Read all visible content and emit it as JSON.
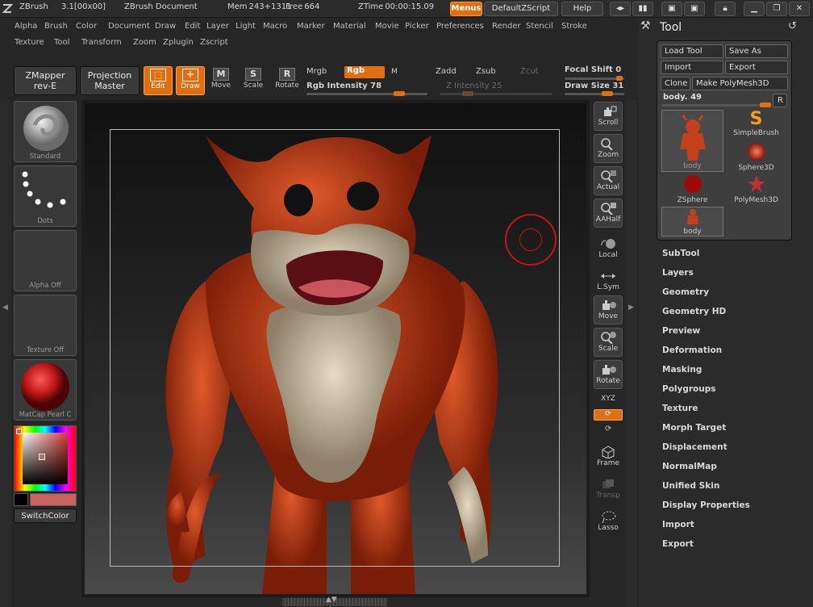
{
  "titlebar": {
    "app": "ZBrush",
    "version": "3.1[00x00]",
    "document": "ZBrush Document",
    "mem": "Mem 243+1311",
    "free": "Free 664",
    "ztime": "ZTime 00:00:15.09",
    "menus_btn": "Menus",
    "script_btn": "DefaultZScript",
    "help_btn": "Help"
  },
  "menu_row1": [
    "Alpha",
    "Brush",
    "Color",
    "Document",
    "Draw",
    "Edit",
    "Layer",
    "Light",
    "Macro",
    "Marker",
    "Material",
    "Movie",
    "Picker",
    "Preferences",
    "Render",
    "Stencil",
    "Stroke"
  ],
  "menu_row2": [
    "Texture",
    "Tool",
    "Transform",
    "Zoom",
    "Zplugin",
    "Zscript"
  ],
  "toolbar": {
    "zmapper": "ZMapper",
    "zmapper_sub": "rev-E",
    "projection": "Projection",
    "projection_sub": "Master",
    "edit": "Edit",
    "draw": "Draw",
    "move": "Move",
    "scale": "Scale",
    "rotate": "Rotate",
    "mrgb": "Mrgb",
    "rgb": "Rgb",
    "m": "M",
    "zadd": "Zadd",
    "zsub": "Zsub",
    "zcut": "Zcut",
    "rgb_intensity": "Rgb Intensity 78",
    "z_intensity": "Z Intensity 25",
    "focal_shift": "Focal Shift 0",
    "draw_size": "Draw Size 31",
    "values": {
      "rgb_intensity": 78,
      "z_intensity": 25,
      "focal_shift": 0,
      "draw_size": 31
    }
  },
  "shelf": {
    "brush": "Standard",
    "stroke": "Dots",
    "alpha": "Alpha  Off",
    "texture": "Texture  Off",
    "material": "MatCap  Pearl  C",
    "switch": "SwitchColor"
  },
  "right_strip": {
    "scroll": "Scroll",
    "zoom": "Zoom",
    "actual": "Actual",
    "aahalf": "AAHalf",
    "local": "Local",
    "lsym": "L.Sym",
    "move": "Move",
    "scale": "Scale",
    "rotate": "Rotate",
    "xyz": "XYZ",
    "frame": "Frame",
    "transp": "Transp",
    "lasso": "Lasso"
  },
  "tool_panel": {
    "title": "Tool",
    "load": "Load Tool",
    "save": "Save As",
    "import": "Import",
    "export": "Export",
    "clone": "Clone",
    "make": "Make PolyMesh3D",
    "current": "body. 49",
    "r": "R",
    "current_value": 49,
    "thumbs": [
      "body",
      "SimpleBrush",
      "Sphere3D",
      "ZSphere",
      "PolyMesh3D",
      "body"
    ],
    "sections": [
      "SubTool",
      "Layers",
      "Geometry",
      "Geometry HD",
      "Preview",
      "Deformation",
      "Masking",
      "Polygroups",
      "Texture",
      "Morph Target",
      "Displacement",
      "NormalMap",
      "Unified Skin",
      "Display Properties",
      "Import",
      "Export"
    ]
  },
  "colors": {
    "accent": "#e06f12",
    "model_red": "#c2401a",
    "model_cream": "#cdbfa6",
    "secondary_color": "#c9635e"
  }
}
